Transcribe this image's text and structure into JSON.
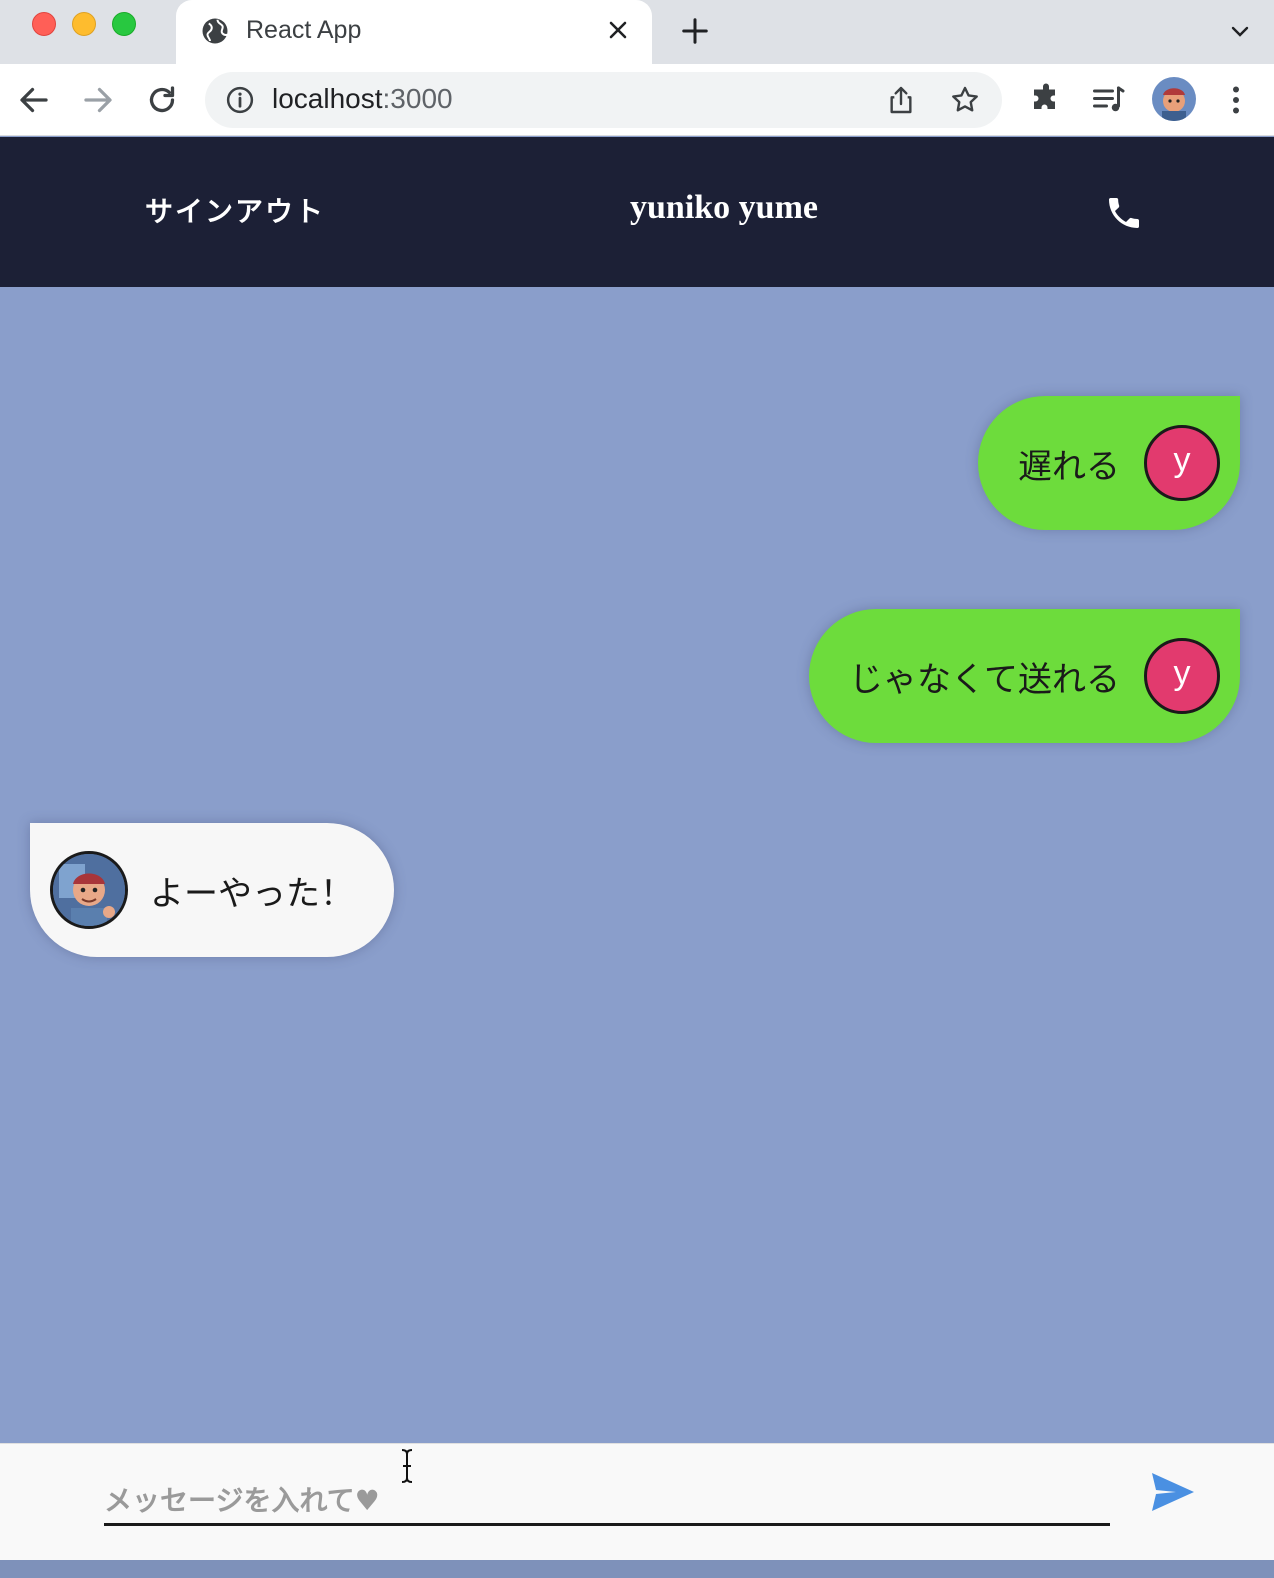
{
  "browser": {
    "tab_title": "React App",
    "address_host": "localhost",
    "address_port": ":3000"
  },
  "header": {
    "signout_label": "サインアウト",
    "title": "yuniko yume"
  },
  "messages": [
    {
      "side": "sent",
      "text": "遅れる",
      "avatar_letter": "y"
    },
    {
      "side": "sent",
      "text": "じゃなくて送れる",
      "avatar_letter": "y"
    },
    {
      "side": "received",
      "text": "よーやった！"
    }
  ],
  "composer": {
    "placeholder": "メッセージを入れて♥",
    "value": ""
  },
  "colors": {
    "header_bg": "#1c2036",
    "chat_bg": "#8a9ecb",
    "sent_bubble": "#6ddc3c",
    "received_bubble": "#f7f7f7",
    "avatar_bg": "#e23a6e",
    "send_icon": "#4a90e2"
  },
  "icons": {
    "call": "phone-icon",
    "send": "send-icon",
    "favicon": "globe-icon"
  }
}
